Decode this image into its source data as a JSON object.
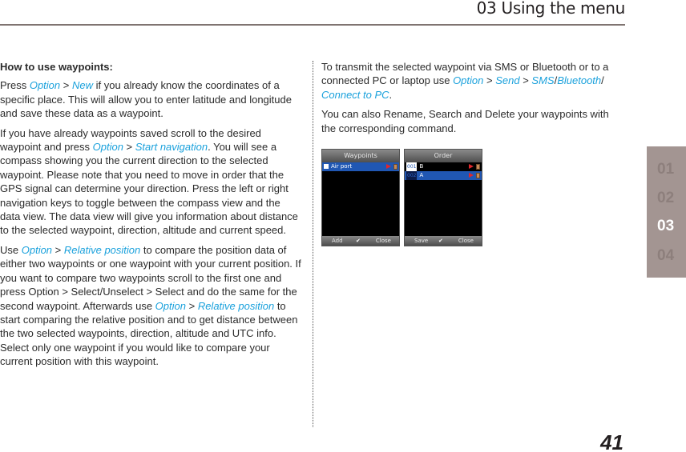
{
  "header": {
    "title": "03 Using the menu"
  },
  "left_column": {
    "heading": "How to use waypoints:",
    "p1": {
      "t1": "Press ",
      "l1": "Option",
      "t2": " > ",
      "l2": "New",
      "t3": " if you already know the coordinates of a specific place. This will allow you to enter latitude and longitude and save these data as a waypoint."
    },
    "p2": {
      "t1": "If you have already waypoints saved scroll to the desired waypoint and press ",
      "l1": "Option",
      "t2": " > ",
      "l2": "Start navigation",
      "t3": ". You will see a compass showing you the current direction to the selected waypoint. Please note that you need to move in order that the GPS signal can determine your direction. Press the left or right navigation keys to toggle between the compass view and the data view. The data view will give you information about distance to the selected waypoint, direction, altitude and current speed."
    },
    "p3": {
      "t1": "Use ",
      "l1": "Option",
      "t2": " > ",
      "l2": "Relative position",
      "t3": " to compare the position data of either two waypoints or one waypoint with your current position. If you want to compare two waypoints scroll to the first one and press Option > Select/Unselect > Select and do the same for the second waypoint. Afterwards use ",
      "l3": "Option",
      "t4": " > ",
      "l4": "Relative position",
      "t5": " to start comparing the relative position and to get distance between the two selected waypoints, direction, altitude and UTC info. Select only one waypoint if you would like to compare your current position with this waypoint."
    }
  },
  "right_column": {
    "p1": {
      "t1": "To transmit the selected waypoint via SMS or Bluetooth or to a connected PC or laptop use ",
      "l1": "Option",
      "t2": " > ",
      "l2": "Send",
      "t3": " > ",
      "l3": "SMS",
      "t4": "/",
      "l4": "Bluetooth",
      "t5": "/ ",
      "l5": "Connect to PC",
      "t6": "."
    },
    "p2": "You can also Rename, Search and Delete your waypoints with the corresponding command."
  },
  "screens": [
    {
      "title": "Waypoints",
      "rows": [
        {
          "label": "Air  port",
          "selected": true
        }
      ],
      "soft_left": "Add",
      "soft_right": "Close"
    },
    {
      "title": "Order",
      "rows": [
        {
          "num": "001",
          "label": "B",
          "selected": false
        },
        {
          "num": "002",
          "label": "A",
          "selected": true
        }
      ],
      "soft_left": "Save",
      "soft_right": "Close"
    }
  ],
  "chapter_tab": {
    "items": [
      "01",
      "02",
      "03",
      "04"
    ],
    "active": "03"
  },
  "page_number": "41",
  "colors": {
    "link": "#1aa1dc",
    "tab_bg": "#a39592",
    "rule": "#7f7471",
    "selection": "#2057b3"
  }
}
